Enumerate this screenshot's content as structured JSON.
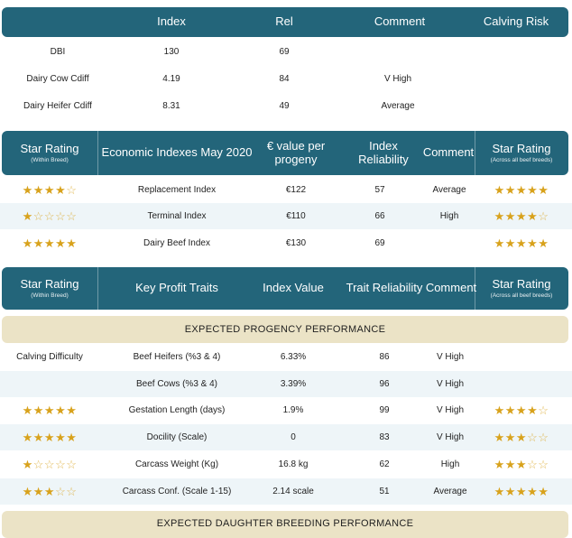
{
  "summary": {
    "headers": [
      "Index",
      "Rel",
      "Comment",
      "Calving Risk"
    ],
    "rows": [
      {
        "label": "DBI",
        "index": "130",
        "rel": "69",
        "comment": ""
      },
      {
        "label": "Dairy Cow Cdiff",
        "index": "4.19",
        "rel": "84",
        "comment": "V High"
      },
      {
        "label": "Dairy Heifer Cdiff",
        "index": "8.31",
        "rel": "49",
        "comment": "Average"
      }
    ]
  },
  "economic": {
    "headers": {
      "star_within": "Star Rating",
      "star_within_sub": "(Within Breed)",
      "name": "Economic Indexes May 2020",
      "value": "€ value per progeny",
      "reliability": "Index Reliability",
      "comment": "Comment",
      "star_across": "Star Rating",
      "star_across_sub": "(Across all beef breeds)"
    },
    "rows": [
      {
        "stars_within": 4,
        "name": "Replacement Index",
        "value": "€122",
        "reliability": "57",
        "comment": "Average",
        "stars_across": 5
      },
      {
        "stars_within": 1,
        "name": "Terminal Index",
        "value": "€110",
        "reliability": "66",
        "comment": "High",
        "stars_across": 4
      },
      {
        "stars_within": 5,
        "name": "Dairy Beef Index",
        "value": "€130",
        "reliability": "69",
        "comment": "",
        "stars_across": 5
      }
    ]
  },
  "traits": {
    "headers": {
      "star_within": "Star Rating",
      "star_within_sub": "(Within Breed)",
      "name": "Key Profit Traits",
      "value": "Index Value",
      "reliability": "Trait Reliability",
      "comment": "Comment",
      "star_across": "Star Rating",
      "star_across_sub": "(Across all beef breeds)"
    },
    "section_title": "EXPECTED PROGENCY PERFORMANCE",
    "rows": [
      {
        "label": "Calving Difficulty",
        "stars_within": null,
        "name": "Beef Heifers (%3 & 4)",
        "value": "6.33%",
        "reliability": "86",
        "comment": "V High",
        "stars_across": null
      },
      {
        "label": "",
        "stars_within": null,
        "name": "Beef Cows (%3 & 4)",
        "value": "3.39%",
        "reliability": "96",
        "comment": "V High",
        "stars_across": null
      },
      {
        "label": "",
        "stars_within": 5,
        "name": "Gestation Length (days)",
        "value": "1.9%",
        "reliability": "99",
        "comment": "V High",
        "stars_across": 4
      },
      {
        "label": "",
        "stars_within": 5,
        "name": "Docility (Scale)",
        "value": "0",
        "reliability": "83",
        "comment": "V High",
        "stars_across": 3
      },
      {
        "label": "",
        "stars_within": 1,
        "name": "Carcass Weight (Kg)",
        "value": "16.8 kg",
        "reliability": "62",
        "comment": "High",
        "stars_across": 3
      },
      {
        "label": "",
        "stars_within": 3,
        "name": "Carcass Conf. (Scale 1-15)",
        "value": "2.14 scale",
        "reliability": "51",
        "comment": "Average",
        "stars_across": 5
      }
    ],
    "footer_section_title": "EXPECTED DAUGHTER BREEDING PERFORMANCE"
  },
  "colors": {
    "header_teal": "#23657a",
    "star_gold": "#d8a21c",
    "section_beige": "#ebe3c6",
    "row_shade": "#eef5f8"
  },
  "icons": {
    "star_filled": "star-filled-icon",
    "star_empty": "star-outline-icon"
  }
}
